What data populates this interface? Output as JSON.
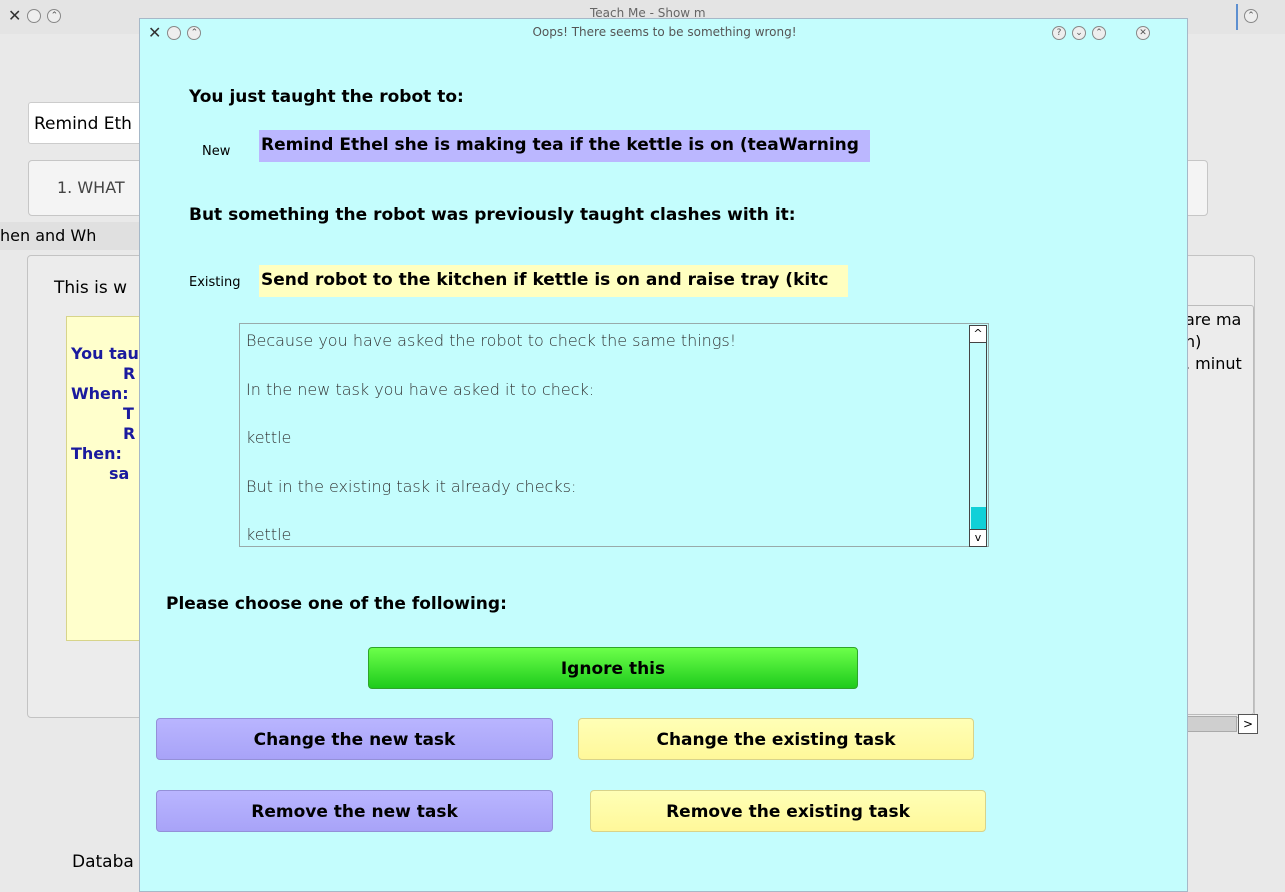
{
  "background_window": {
    "title": "Teach Me - Show m",
    "task_name_value": "Remind Eth",
    "tab_label": "1. WHAT",
    "section_label": "hen and Wh",
    "panel_intro": "This is w",
    "summary_lines": [
      "You tau",
      "R",
      "When:",
      "T",
      "R",
      "Then:",
      "sa"
    ],
    "right_panel_lines": [
      "are ma",
      "h)",
      ". minut"
    ],
    "footer_label": "Databa"
  },
  "dialog": {
    "title": "Oops! There seems to be something wrong!",
    "taught_heading": "You just taught the robot to:",
    "new_label": "New",
    "new_task": "Remind Ethel she is making tea if the kettle is on (teaWarning",
    "clash_heading": "But something the robot was previously taught clashes with it:",
    "existing_label": "Existing",
    "existing_task": "Send robot to the kitchen if kettle is on and raise tray (kitc",
    "explanation_lines": [
      "Because you have asked the robot to check the same things!",
      "In the new task you have asked it to check:",
      "kettle",
      "But in the existing task it already checks:",
      "kettle"
    ],
    "choose_heading": "Please choose one of the following:",
    "buttons": {
      "ignore": "Ignore this",
      "change_new": "Change the new task",
      "change_existing": "Change the existing task",
      "remove_new": "Remove the new task",
      "remove_existing": "Remove the existing task"
    }
  },
  "colors": {
    "dialog_bg": "#c4fdfd",
    "new_task_bg": "#bbb7ff",
    "existing_task_bg": "#ffffc0",
    "ignore_green": "#3ee034",
    "thumb_cyan": "#10d0d8"
  }
}
